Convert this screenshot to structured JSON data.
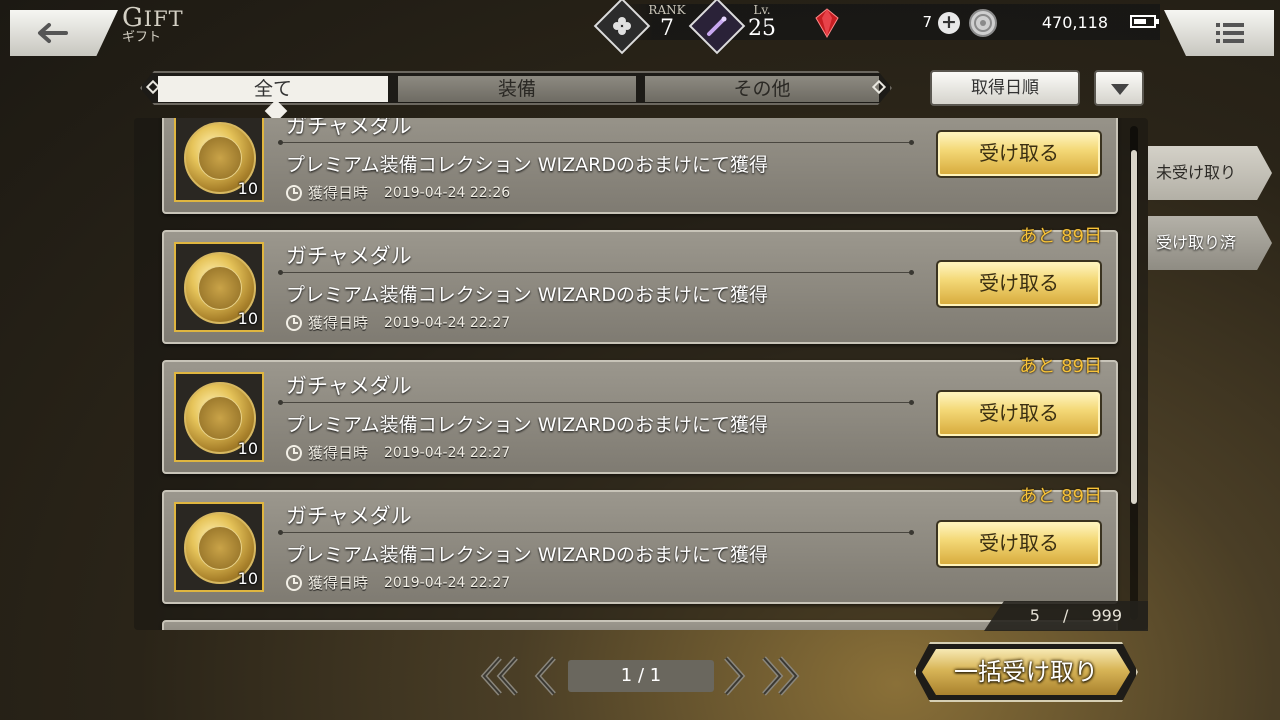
{
  "header": {
    "title_first": "G",
    "title_rest": "IFT",
    "subtitle": "ギフト",
    "rank_label": "RANK",
    "rank_value": "7",
    "level_label": "Lv.",
    "level_value": "25",
    "gem_count": "7",
    "coin_count": "470,118"
  },
  "tabs": {
    "all": "全て",
    "equipment": "装備",
    "other": "その他",
    "selected": "all"
  },
  "sort": {
    "label": "取得日順"
  },
  "side_filter": {
    "unreceived": "未受け取り",
    "received": "受け取り済"
  },
  "gifts": [
    {
      "title": "ガチャメダル",
      "description": "プレミアム装備コレクション WIZARDのおまけにて獲得",
      "date_label": "獲得日時",
      "date": "2019-04-24 22:26",
      "count": "10",
      "days_left": "",
      "button": "受け取る"
    },
    {
      "title": "ガチャメダル",
      "description": "プレミアム装備コレクション WIZARDのおまけにて獲得",
      "date_label": "獲得日時",
      "date": "2019-04-24 22:27",
      "count": "10",
      "days_left": "あと 89日",
      "button": "受け取る"
    },
    {
      "title": "ガチャメダル",
      "description": "プレミアム装備コレクション WIZARDのおまけにて獲得",
      "date_label": "獲得日時",
      "date": "2019-04-24 22:27",
      "count": "10",
      "days_left": "あと 89日",
      "button": "受け取る"
    },
    {
      "title": "ガチャメダル",
      "description": "プレミアム装備コレクション WIZARDのおまけにて獲得",
      "date_label": "獲得日時",
      "date": "2019-04-24 22:27",
      "count": "10",
      "days_left": "あと 89日",
      "button": "受け取る"
    }
  ],
  "list_count": {
    "current": "5",
    "separator": "/",
    "max": "999"
  },
  "pagination": {
    "indicator": "1 / 1"
  },
  "bulk_button": "一括受け取り",
  "icons": {
    "back": "arrow-left-icon",
    "menu": "hamburger-menu-icon",
    "gem": "red-gem-icon",
    "coin": "coin-icon",
    "battery": "battery-icon",
    "clock": "clock-icon",
    "medal": "gacha-medal-icon"
  },
  "colors": {
    "accent_gold": "#e6c45a",
    "days_left": "#f8c33a",
    "row_bg": "#8c887f"
  }
}
